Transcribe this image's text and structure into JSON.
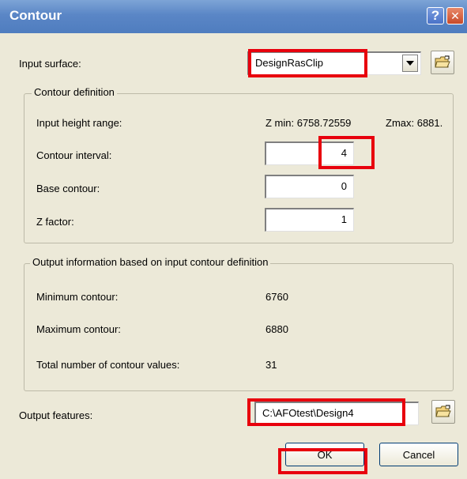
{
  "window": {
    "title": "Contour",
    "help_glyph": "?",
    "close_glyph": "✕"
  },
  "input_surface": {
    "label": "Input surface:",
    "value": "DesignRasClip"
  },
  "contour_definition": {
    "title": "Contour definition",
    "height_range_label": "Input height range:",
    "zmin_text": "Z min: 6758.72559",
    "zmax_text": "Zmax: 6881.",
    "interval_label": "Contour interval:",
    "interval_value": "4",
    "base_label": "Base contour:",
    "base_value": "0",
    "zfactor_label": "Z factor:",
    "zfactor_value": "1"
  },
  "output_info": {
    "title": "Output information based on input contour definition",
    "min_label": "Minimum contour:",
    "min_value": "6760",
    "max_label": "Maximum contour:",
    "max_value": "6880",
    "total_label": "Total number of contour values:",
    "total_value": "31"
  },
  "output_features": {
    "label": "Output features:",
    "value": "C:\\AFOtest\\Design4"
  },
  "buttons": {
    "ok": "OK",
    "cancel": "Cancel"
  },
  "colors": {
    "titlebar": "#5a86c6",
    "dialog_bg": "#ece9d8",
    "highlight": "#e8000d"
  }
}
